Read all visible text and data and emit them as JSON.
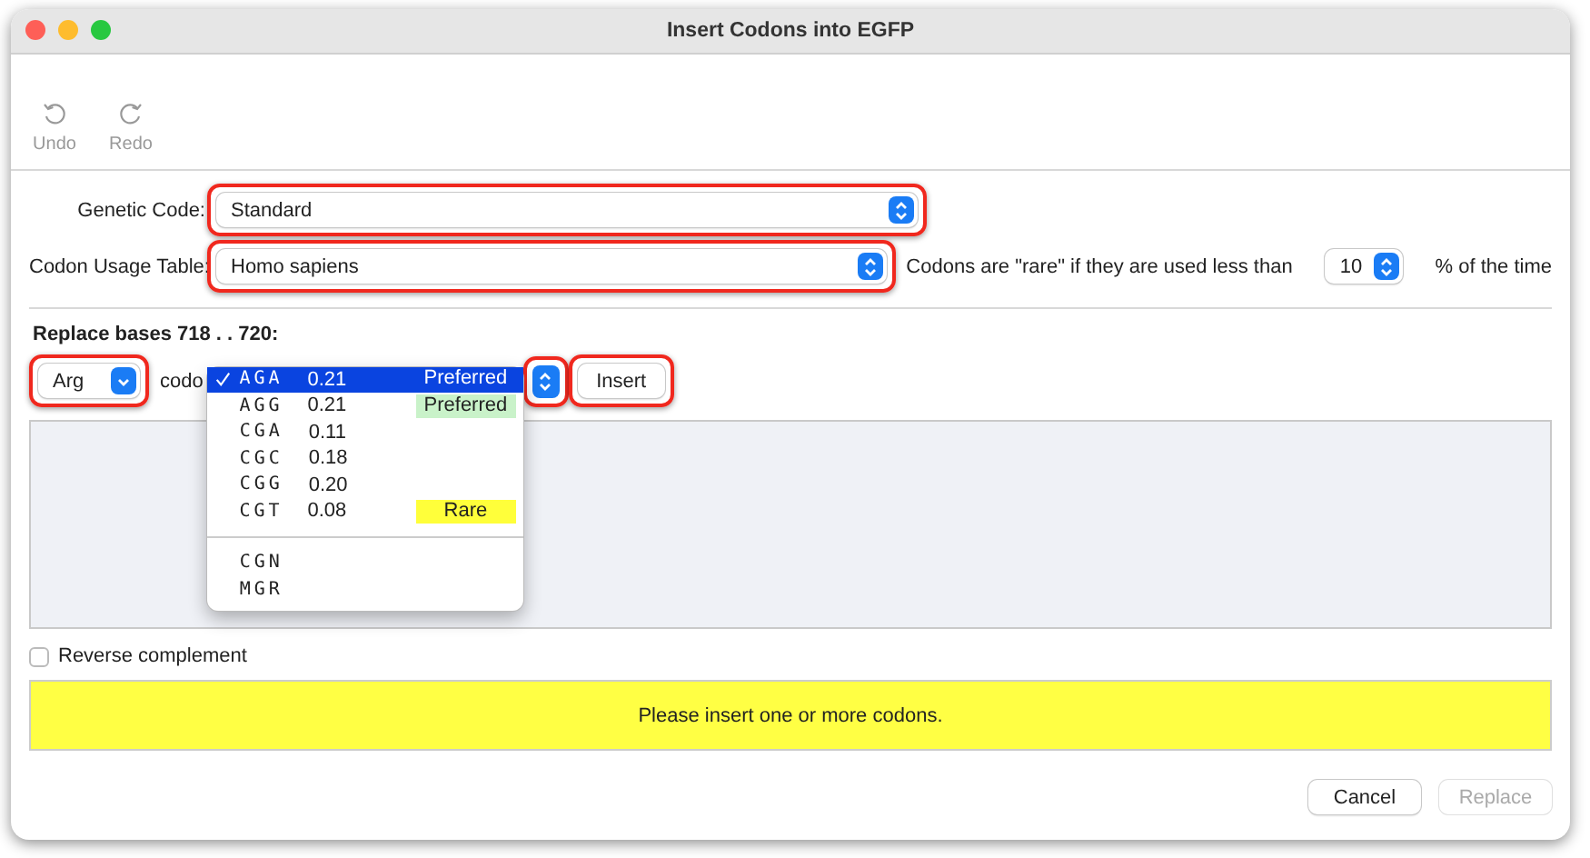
{
  "window": {
    "title": "Insert Codons into EGFP"
  },
  "toolbar": [
    {
      "label": "Undo",
      "disabled": true
    },
    {
      "label": "Redo",
      "disabled": true
    }
  ],
  "genetic_code": {
    "label": "Genetic Code:",
    "value": "Standard",
    "highlighted": true
  },
  "codon_usage": {
    "label": "Codon Usage Table:",
    "value": "Homo sapiens",
    "highlighted": true,
    "rare_text": "Codons are \"rare\" if they are used less than",
    "threshold": "10",
    "suffix": "% of the time"
  },
  "replace_label": "Replace bases 718 . . 720:",
  "amino_acid": {
    "value": "Arg",
    "highlighted": true
  },
  "codon_label": "codo",
  "codon_menu": {
    "highlighted": true,
    "groups": [
      [
        {
          "codon": "AGA",
          "freq": "0.21",
          "tag": "Preferred",
          "selected": true
        },
        {
          "codon": "AGG",
          "freq": "0.21",
          "tag": "Preferred",
          "color": "#c9f2c9",
          "selected": false
        },
        {
          "codon": "CGA",
          "freq": "0.11",
          "selected": false
        },
        {
          "codon": "CGC",
          "freq": "0.18",
          "selected": false
        },
        {
          "codon": "CGG",
          "freq": "0.20",
          "selected": false
        },
        {
          "codon": "CGT",
          "freq": "0.08",
          "tag": "Rare",
          "color": "#ffff3a",
          "selected": false
        }
      ],
      [
        {
          "codon": "CGN",
          "selected": false
        },
        {
          "codon": "MGR",
          "selected": false
        }
      ]
    ]
  },
  "insert_button": {
    "label": "Insert",
    "highlighted": true
  },
  "reverse_complement": {
    "label": "Reverse complement",
    "checked": false
  },
  "message": "Please insert one or more codons.",
  "buttons": [
    {
      "label": "Cancel",
      "disabled": false
    },
    {
      "label": "Replace",
      "disabled": true
    }
  ]
}
